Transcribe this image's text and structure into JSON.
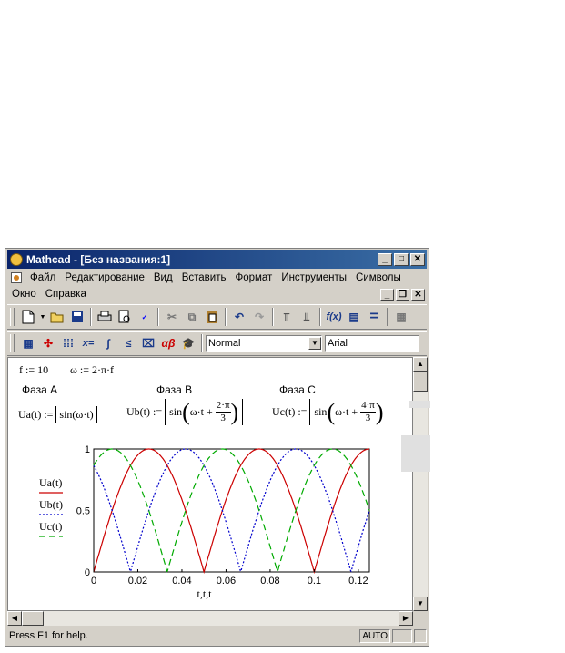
{
  "window": {
    "title": "Mathcad - [Без названия:1]"
  },
  "menu": {
    "row1": [
      "Файл",
      "Редактирование",
      "Вид",
      "Вставить",
      "Формат",
      "Инструменты",
      "Символы"
    ],
    "row1_ul": [
      "Ф",
      "Р",
      "В",
      "В",
      "",
      "И",
      "С"
    ],
    "row2": [
      "Окно",
      "Справка"
    ]
  },
  "format_bar": {
    "style": "Normal",
    "font": "Arial"
  },
  "worksheet": {
    "def_f": "f := 10",
    "def_omega": "ω := 2·π·f",
    "phase_a": "Фаза A",
    "phase_b": "Фаза B",
    "phase_c": "Фаза C",
    "ua_lhs": "Ua(t) :=",
    "ua_body": "sin(ω·t)",
    "ub_lhs": "Ub(t) :=",
    "ub_sin": "sin",
    "ub_arg": "ω·t +",
    "ub_num": "2·π",
    "ub_den": "3",
    "uc_lhs": "Uc(t) :=",
    "uc_sin": "sin",
    "uc_arg": "ω·t +",
    "uc_num": "4·π",
    "uc_den": "3"
  },
  "chart_data": {
    "type": "line",
    "xlabel": "t,t,t",
    "xlim": [
      0,
      0.125
    ],
    "ylim": [
      0,
      1
    ],
    "xticks": [
      "0",
      "0.02",
      "0.04",
      "0.06",
      "0.08",
      "0.1",
      "0.12"
    ],
    "yticks": [
      "0",
      "0.5",
      "1"
    ],
    "legend_position": "left",
    "series": [
      {
        "name": "Ua(t)",
        "color": "#cc0000",
        "style": "solid",
        "phase": 0
      },
      {
        "name": "Ub(t)",
        "color": "#0000cc",
        "style": "dotted",
        "phase": 2.0944
      },
      {
        "name": "Uc(t)",
        "color": "#00aa00",
        "style": "dashed",
        "phase": 4.1888
      }
    ],
    "formula": "|sin(2·π·10·t + phase)|"
  },
  "status": {
    "help": "Press F1 for help.",
    "mode": "AUTO"
  },
  "icons": [
    "new-doc-icon",
    "open-icon",
    "save-icon",
    "print-icon",
    "preview-icon",
    "spell-icon",
    "cut-icon",
    "copy-icon",
    "paste-icon",
    "undo-icon",
    "redo-icon",
    "align-top-icon",
    "align-bottom-icon",
    "function-icon",
    "unit-icon",
    "equals-icon",
    "resources-icon",
    "calculator-icon",
    "graph-icon",
    "matrix-icon",
    "evaluate-icon",
    "calculus-icon",
    "boolean-icon",
    "programming-icon",
    "greek-icon",
    "symbolic-icon"
  ]
}
